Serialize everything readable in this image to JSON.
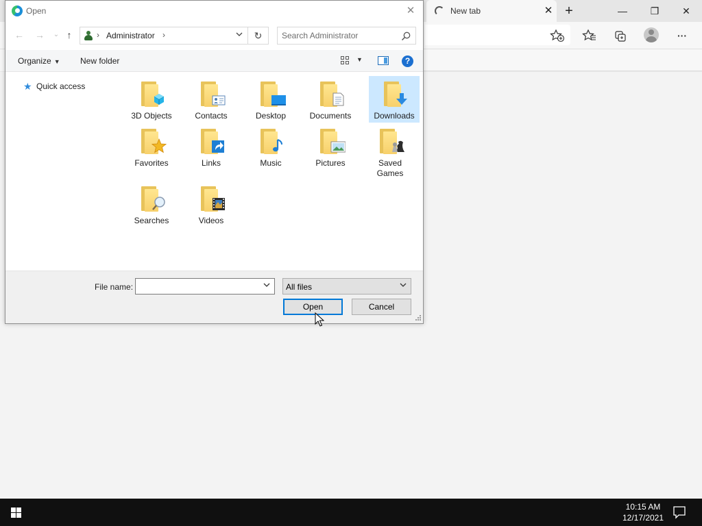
{
  "browser": {
    "tab_title": "New tab",
    "tab_close": "✕",
    "new_tab": "+",
    "window_controls": {
      "minimize": "—",
      "restore": "❐",
      "close": "✕"
    },
    "toolbar_icons": [
      "add-favorite-icon",
      "favorites-icon",
      "collections-icon",
      "profile-icon",
      "more-icon"
    ],
    "more_label": "···"
  },
  "dialog": {
    "title": "Open",
    "close_label": "✕",
    "nav": {
      "back": "←",
      "forward": "→",
      "recent": "⌄",
      "up": "↑"
    },
    "breadcrumb": {
      "separator": "›",
      "location": "Administrator",
      "trailing_separator": "›"
    },
    "refresh_label": "↻",
    "search": {
      "placeholder": "Search Administrator"
    },
    "commands": {
      "organize": "Organize",
      "new_folder": "New folder",
      "help": "?"
    },
    "nav_pane": {
      "quick_access": "Quick access"
    },
    "items": [
      {
        "label": "3D Objects",
        "icon": "3d-objects-icon",
        "selected": false
      },
      {
        "label": "Contacts",
        "icon": "contacts-icon",
        "selected": false
      },
      {
        "label": "Desktop",
        "icon": "desktop-icon",
        "selected": false
      },
      {
        "label": "Documents",
        "icon": "documents-icon",
        "selected": false
      },
      {
        "label": "Downloads",
        "icon": "download-arrow-icon",
        "selected": true
      },
      {
        "label": "Favorites",
        "icon": "star-icon",
        "selected": false
      },
      {
        "label": "Links",
        "icon": "link-arrow-icon",
        "selected": false
      },
      {
        "label": "Music",
        "icon": "music-note-icon",
        "selected": false
      },
      {
        "label": "Pictures",
        "icon": "picture-icon",
        "selected": false
      },
      {
        "label": "Saved\nGames",
        "icon": "chess-piece-icon",
        "selected": false
      },
      {
        "label": "Searches",
        "icon": "magnifier-icon",
        "selected": false
      },
      {
        "label": "Videos",
        "icon": "film-icon",
        "selected": false
      }
    ],
    "file_name": {
      "label": "File name:",
      "value": ""
    },
    "file_type": {
      "value": "All files"
    },
    "buttons": {
      "open": "Open",
      "cancel": "Cancel"
    }
  },
  "taskbar": {
    "time": "10:15 AM",
    "date": "12/17/2021"
  },
  "colors": {
    "accent": "#0078d7",
    "selection": "#cce8ff",
    "folder": "#f7d06b",
    "taskbar": "#101010"
  }
}
